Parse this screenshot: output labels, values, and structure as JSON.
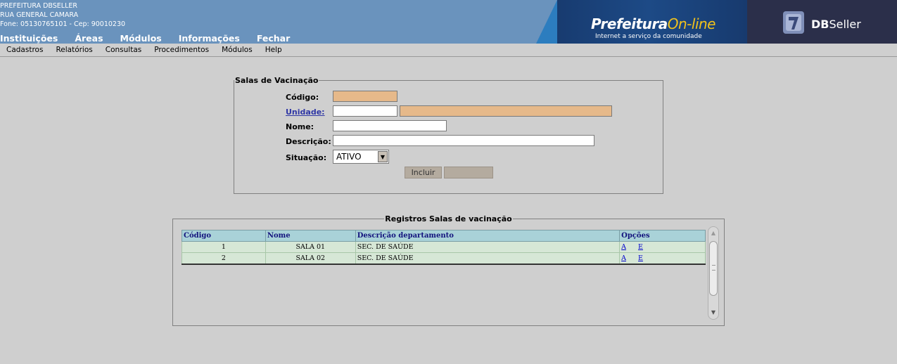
{
  "header": {
    "org_name": "PREFEITURA DBSELLER",
    "address": "RUA GENERAL CAMARA",
    "contact": "Fone: 05130765101  -  Cep: 90010230",
    "nav": [
      "Instituições",
      "Áreas",
      "Módulos",
      "Informações",
      "Fechar"
    ],
    "brand_title_main": "Prefeitura",
    "brand_title_accent": "On-line",
    "brand_subtitle": "Internet a serviço da comunidade",
    "vendor_bold": "DB",
    "vendor_rest": "Seller"
  },
  "menu": [
    "Cadastros",
    "Relatórios",
    "Consultas",
    "Procedimentos",
    "Módulos",
    "Help"
  ],
  "form": {
    "legend": "Salas de Vacinação",
    "labels": {
      "codigo": "Código:",
      "unidade": "Unidade:",
      "nome": "Nome:",
      "descricao": "Descrição:",
      "situacao": "Situação:"
    },
    "values": {
      "codigo": "",
      "unidade_code": "",
      "unidade_name": "",
      "nome": "",
      "descricao": ""
    },
    "situacao_selected": "ATIVO",
    "buttons": {
      "incluir": "Incluir",
      "second": ""
    }
  },
  "grid": {
    "legend": "Registros Salas de vacinação",
    "columns": [
      "Código",
      "Nome",
      "Descrição departamento",
      "Opções"
    ],
    "rows": [
      {
        "codigo": "1",
        "nome": "SALA 01",
        "descricao": "SEC. DE SAÚDE",
        "alterar": "A",
        "excluir": "E"
      },
      {
        "codigo": "2",
        "nome": "SALA 02",
        "descricao": "SEC. DE SAÚDE",
        "alterar": "A",
        "excluir": "E"
      }
    ]
  }
}
